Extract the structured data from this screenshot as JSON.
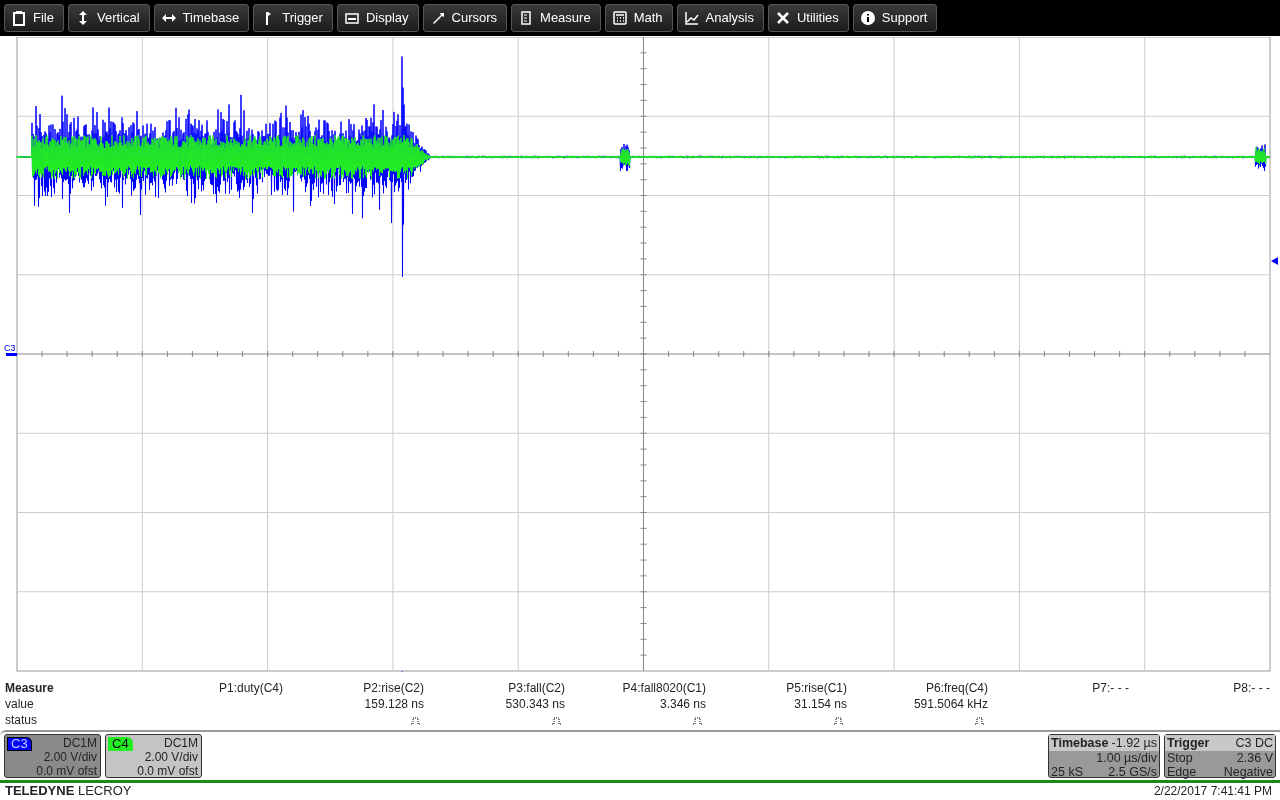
{
  "menu": [
    {
      "label": "File"
    },
    {
      "label": "Vertical"
    },
    {
      "label": "Timebase"
    },
    {
      "label": "Trigger"
    },
    {
      "label": "Display"
    },
    {
      "label": "Cursors"
    },
    {
      "label": "Measure"
    },
    {
      "label": "Math"
    },
    {
      "label": "Analysis"
    },
    {
      "label": "Utilities"
    },
    {
      "label": "Support"
    }
  ],
  "grid": {
    "channel_marker": "C3"
  },
  "measure": {
    "title": "Measure",
    "row_labels": [
      "value",
      "status"
    ],
    "params": [
      {
        "name": "P1:duty(C4)",
        "status_shown": false
      },
      {
        "name": "P2:rise(C2)",
        "value": "159.128 ns",
        "status_shown": true
      },
      {
        "name": "P3:fall(C2)",
        "value": "530.343 ns",
        "status_shown": true
      },
      {
        "name": "P4:fall8020(C1)",
        "value": "3.346 ns",
        "status_shown": true
      },
      {
        "name": "P5:rise(C1)",
        "value": "31.154 ns",
        "status_shown": true
      },
      {
        "name": "P6:freq(C4)",
        "value": "591.5064 kHz",
        "status_shown": true
      },
      {
        "name": "P7:- - -",
        "status_shown": false
      },
      {
        "name": "P8:- - -",
        "status_shown": false
      }
    ]
  },
  "channels": [
    {
      "name": "C3",
      "coupling": "DC1M",
      "scale": "2.00 V/div",
      "offset": "0.0 mV ofst",
      "color": "#0000ff",
      "selected": true
    },
    {
      "name": "C4",
      "coupling": "DC1M",
      "scale": "2.00 V/div",
      "offset": "0.0 mV ofst",
      "color": "#22ee22",
      "selected": false
    }
  ],
  "timebase": {
    "title": "Timebase",
    "delay": "-1.92 µs",
    "scale": "1.00 µs/div",
    "samples": "25 kS",
    "rate": "2.5 GS/s"
  },
  "trigger": {
    "title": "Trigger",
    "source": "C3 DC",
    "mode": "Stop",
    "level": "2.36 V",
    "type": "Edge",
    "slope": "Negative"
  },
  "brand": {
    "bold": "TELEDYNE",
    "light": "LECROY"
  },
  "timestamp": "2/22/2017 7:41:41 PM"
}
